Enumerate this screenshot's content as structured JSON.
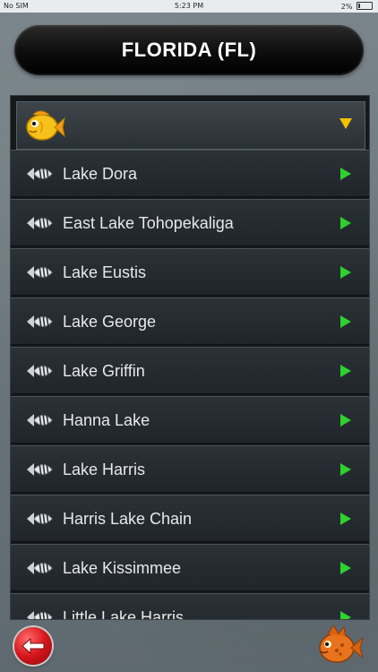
{
  "status": {
    "carrier": "No SIM",
    "time": "5:23 PM",
    "battery": "2%"
  },
  "header": {
    "title": "FLORIDA (FL)"
  },
  "lakes": [
    {
      "label": "Lake Dora"
    },
    {
      "label": "East Lake Tohopekaliga"
    },
    {
      "label": "Lake Eustis"
    },
    {
      "label": "Lake George"
    },
    {
      "label": "Lake Griffin"
    },
    {
      "label": "Hanna Lake"
    },
    {
      "label": "Lake Harris"
    },
    {
      "label": "Harris Lake Chain"
    },
    {
      "label": "Lake Kissimmee"
    },
    {
      "label": "Little Lake Harris"
    }
  ],
  "colors": {
    "accent_arrow": "#2ed12e",
    "dropdown_arrow": "#f5c000",
    "back_button": "#d6151b"
  },
  "icons": {
    "header_fish": "yellow-fish-icon",
    "row_icon": "fishing-lure-icon",
    "row_arrow": "play-arrow-icon",
    "dropdown": "triangle-down-icon",
    "back": "back-arrow-icon",
    "logo": "orange-fish-icon"
  }
}
